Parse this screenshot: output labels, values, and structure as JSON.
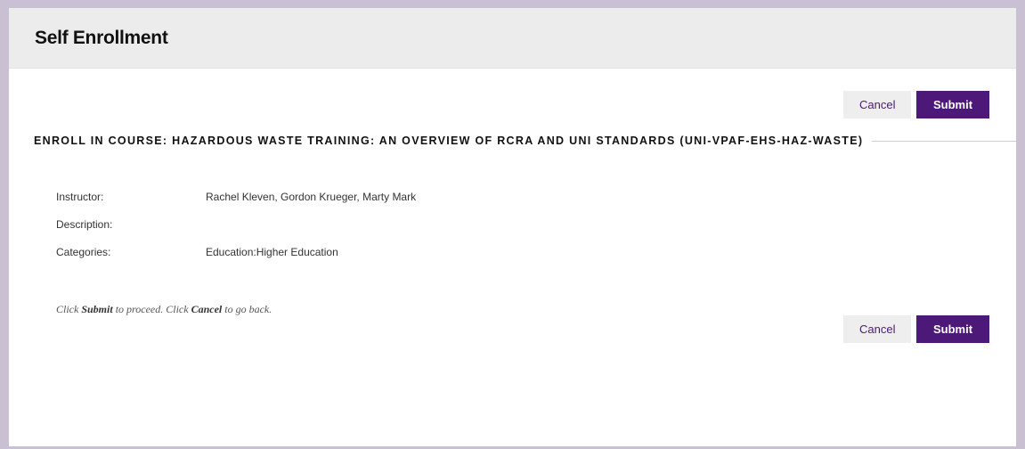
{
  "page": {
    "title": "Self Enrollment"
  },
  "actions": {
    "cancel_label": "Cancel",
    "submit_label": "Submit"
  },
  "course": {
    "heading": "ENROLL IN COURSE: HAZARDOUS WASTE TRAINING: AN OVERVIEW OF RCRA AND UNI STANDARDS (UNI-VPAF-EHS-HAZ-WASTE)",
    "fields": [
      {
        "label": "Instructor:",
        "value": "Rachel Kleven, Gordon Krueger, Marty Mark"
      },
      {
        "label": "Description:",
        "value": ""
      },
      {
        "label": "Categories:",
        "value": "Education:Higher Education"
      }
    ]
  },
  "instruction": {
    "part1": "Click ",
    "submit_word": "Submit",
    "part2": " to proceed. Click ",
    "cancel_word": "Cancel",
    "part3": " to go back."
  },
  "colors": {
    "accent": "#4d1979",
    "cancel_bg": "#eeeeee",
    "header_bg": "#ececec",
    "border": "#c9c0d3"
  }
}
